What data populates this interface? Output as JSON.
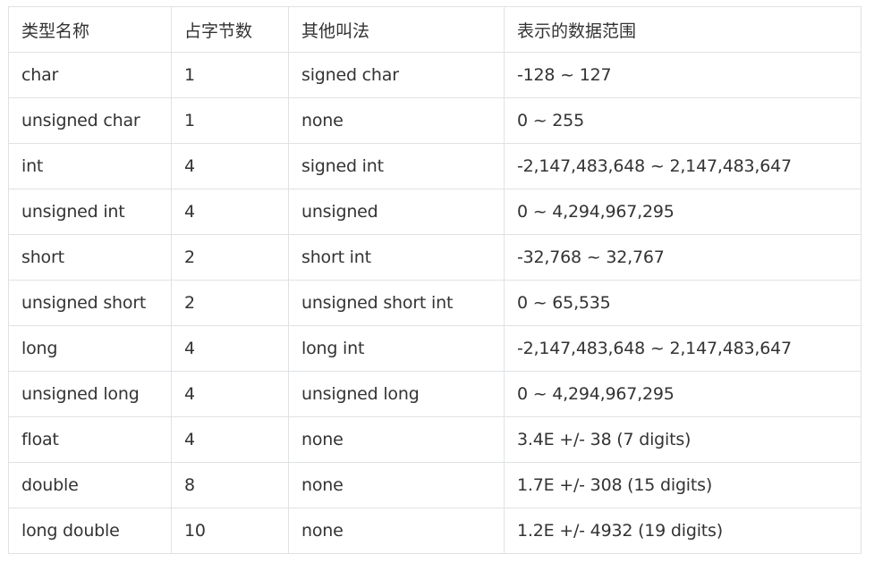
{
  "table": {
    "headers": [
      "类型名称",
      "占字节数",
      "其他叫法",
      "表示的数据范围"
    ],
    "rows": [
      [
        "char",
        "1",
        "signed char",
        "-128 ~ 127"
      ],
      [
        "unsigned char",
        "1",
        "none",
        "0 ~ 255"
      ],
      [
        "int",
        "4",
        "signed int",
        "-2,147,483,648 ~ 2,147,483,647"
      ],
      [
        "unsigned int",
        "4",
        "unsigned",
        "0 ~ 4,294,967,295"
      ],
      [
        "short",
        "2",
        "short int",
        "-32,768 ~ 32,767"
      ],
      [
        "unsigned short",
        "2",
        "unsigned short int",
        "0 ~ 65,535"
      ],
      [
        "long",
        "4",
        "long int",
        "-2,147,483,648 ~ 2,147,483,647"
      ],
      [
        "unsigned long",
        "4",
        "unsigned long",
        "0 ~ 4,294,967,295"
      ],
      [
        "float",
        "4",
        "none",
        "3.4E +/- 38 (7 digits)"
      ],
      [
        "double",
        "8",
        "none",
        "1.7E +/- 308 (15 digits)"
      ],
      [
        "long double",
        "10",
        "none",
        "1.2E +/- 4932 (19 digits)"
      ]
    ]
  }
}
